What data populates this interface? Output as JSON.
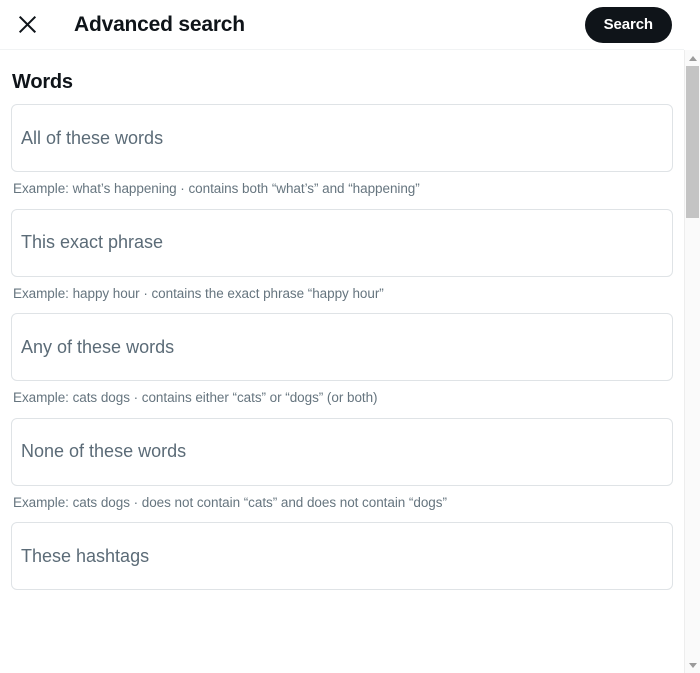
{
  "header": {
    "close_icon": "close-icon",
    "title": "Advanced search",
    "search_label": "Search"
  },
  "main": {
    "section_title": "Words",
    "fields": [
      {
        "placeholder": "All of these words",
        "value": "",
        "hint": "Example: what’s happening · contains both “what’s” and “happening”"
      },
      {
        "placeholder": "This exact phrase",
        "value": "",
        "hint": "Example: happy hour · contains the exact phrase “happy hour”"
      },
      {
        "placeholder": "Any of these words",
        "value": "",
        "hint": "Example: cats dogs · contains either “cats” or “dogs” (or both)"
      },
      {
        "placeholder": "None of these words",
        "value": "",
        "hint": "Example: cats dogs · does not contain “cats” and does not contain “dogs”"
      },
      {
        "placeholder": "These hashtags",
        "value": "",
        "hint": ""
      }
    ]
  },
  "scrollbar": {
    "up_icon": "triangle-up-icon",
    "down_icon": "triangle-down-icon"
  },
  "colors": {
    "accent": "#0f1419",
    "text_primary": "#0f1419",
    "text_secondary": "#66757f",
    "border": "#dfe3e6",
    "background": "#ffffff"
  }
}
